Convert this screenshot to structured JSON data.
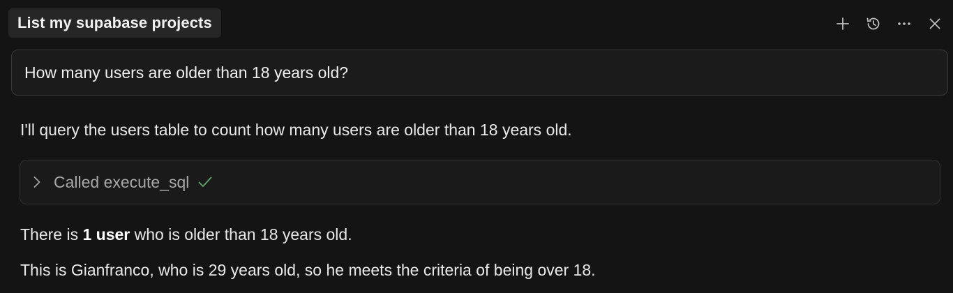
{
  "header": {
    "title": "List my supabase projects",
    "actions": [
      {
        "name": "new-chat",
        "icon": "plus-icon"
      },
      {
        "name": "history",
        "icon": "history-icon"
      },
      {
        "name": "more",
        "icon": "ellipsis-icon"
      },
      {
        "name": "close",
        "icon": "close-icon"
      }
    ]
  },
  "conversation": {
    "user_message": "How many users are older than 18 years old?",
    "assistant_intro": "I'll query the users table to count how many users are older than 18 years old.",
    "tool_call": {
      "label": "Called execute_sql",
      "status_icon": "checkmark-icon",
      "status_color": "#5fa86a",
      "expanded": false
    },
    "result": {
      "prefix": "There is ",
      "bold": "1 user",
      "suffix": " who is older than 18 years old."
    },
    "detail": "This is Gianfranco, who is 29 years old, so he meets the criteria of being over 18."
  },
  "colors": {
    "background": "#141414",
    "chip_background": "#262626",
    "card_border": "#3a3a3a",
    "muted_text": "#a8a8a8",
    "icon": "#bdbdbd"
  }
}
